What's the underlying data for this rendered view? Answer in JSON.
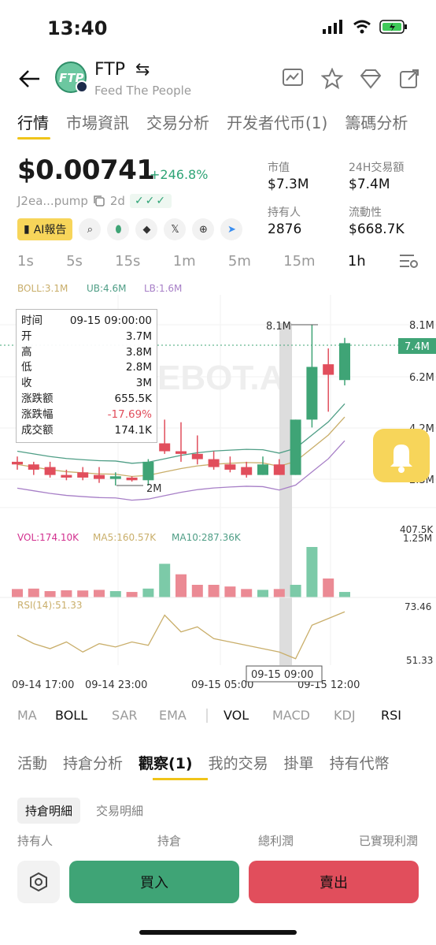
{
  "status": {
    "time": "13:40"
  },
  "header": {
    "symbol": "FTP",
    "logo_text": "FTP",
    "full_name": "Feed The People"
  },
  "tabs": [
    "行情",
    "市場資訊",
    "交易分析",
    "开发者代币(1)",
    "籌碼分析"
  ],
  "price": {
    "value": "$0.00741",
    "change": "+246.8%"
  },
  "token": {
    "address": "J2ea...pump",
    "age": "2d",
    "checks": "✓✓✓"
  },
  "stats": {
    "market_cap_label": "市值",
    "market_cap": "$7.3M",
    "volume_label": "24H交易額",
    "volume": "$7.4M",
    "holders_label": "持有人",
    "holders": "2876",
    "liquidity_label": "流動性",
    "liquidity": "$668.7K"
  },
  "ai_button": "AI報告",
  "intervals": [
    "1s",
    "5s",
    "15s",
    "1m",
    "5m",
    "15m",
    "1h"
  ],
  "chart": {
    "boll": "BOLL:3.1M",
    "ub": "UB:4.6M",
    "lb": "LB:1.6M",
    "y_labels": [
      "8.1M",
      "6.2M",
      "4.2M",
      "2.3M"
    ],
    "current_price_label": "7.4M",
    "high_marker": "8.1M",
    "low_marker": "2M",
    "watermark": "EBOT.A",
    "vol": "VOL:174.10K",
    "ma5": "MA5:160.57K",
    "ma10": "MA10:287.36K",
    "vol_top": "407.5K",
    "vol_mid": "1.25M",
    "rsi": "RSI(14):51.33",
    "rsi_top": "73.46",
    "rsi_bottom": "51.33",
    "x_labels": [
      "09-14 17:00",
      "09-14 23:00",
      "09-15 05:00",
      "09-15 12:00"
    ],
    "crosshair_time": "09-15 09:00"
  },
  "tooltip": {
    "rows": [
      {
        "k": "时间",
        "v": "09-15 09:00:00"
      },
      {
        "k": "开",
        "v": "3.7M"
      },
      {
        "k": "高",
        "v": "3.8M"
      },
      {
        "k": "低",
        "v": "2.8M"
      },
      {
        "k": "收",
        "v": "3M"
      },
      {
        "k": "涨跌额",
        "v": "655.5K"
      },
      {
        "k": "涨跌幅",
        "v": "-17.69%"
      },
      {
        "k": "成交额",
        "v": "174.1K"
      }
    ]
  },
  "chart_data": {
    "type": "candlestick",
    "candles": [
      {
        "o": 2.9,
        "h": 3.1,
        "l": 2.6,
        "c": 2.8
      },
      {
        "o": 2.8,
        "h": 2.9,
        "l": 2.4,
        "c": 2.6
      },
      {
        "o": 2.7,
        "h": 2.9,
        "l": 2.3,
        "c": 2.4
      },
      {
        "o": 2.4,
        "h": 2.6,
        "l": 2.2,
        "c": 2.3
      },
      {
        "o": 2.5,
        "h": 2.7,
        "l": 2.2,
        "c": 2.3
      },
      {
        "o": 2.4,
        "h": 2.7,
        "l": 2.1,
        "c": 2.25
      },
      {
        "o": 2.25,
        "h": 2.5,
        "l": 2.0,
        "c": 2.35
      },
      {
        "o": 2.3,
        "h": 2.35,
        "l": 2.15,
        "c": 2.2
      },
      {
        "o": 2.2,
        "h": 3.0,
        "l": 2.0,
        "c": 2.9
      },
      {
        "o": 3.6,
        "h": 4.5,
        "l": 3.2,
        "c": 3.3
      },
      {
        "o": 3.3,
        "h": 4.4,
        "l": 2.9,
        "c": 3.2
      },
      {
        "o": 3.2,
        "h": 3.9,
        "l": 2.8,
        "c": 3.0
      },
      {
        "o": 3.0,
        "h": 3.3,
        "l": 2.6,
        "c": 2.7
      },
      {
        "o": 2.8,
        "h": 3.1,
        "l": 2.5,
        "c": 2.6
      },
      {
        "o": 2.7,
        "h": 2.9,
        "l": 2.3,
        "c": 2.4
      },
      {
        "o": 2.4,
        "h": 3.1,
        "l": 2.4,
        "c": 2.8
      },
      {
        "o": 2.8,
        "h": 3.0,
        "l": 2.4,
        "c": 2.4
      },
      {
        "o": 2.4,
        "h": 4.5,
        "l": 2.4,
        "c": 4.5
      },
      {
        "o": 4.5,
        "h": 8.1,
        "l": 4.2,
        "c": 6.5
      },
      {
        "o": 6.6,
        "h": 7.2,
        "l": 4.8,
        "c": 6.2
      },
      {
        "o": 6.0,
        "h": 7.6,
        "l": 5.8,
        "c": 7.4
      }
    ],
    "volumes": [
      40,
      42,
      30,
      34,
      33,
      36,
      30,
      26,
      42,
      160,
      110,
      60,
      60,
      52,
      40,
      36,
      40,
      60,
      240,
      90,
      26
    ],
    "vol_colors": [
      "red",
      "red",
      "red",
      "red",
      "red",
      "red",
      "green",
      "red",
      "green",
      "green",
      "red",
      "red",
      "red",
      "red",
      "red",
      "green",
      "red",
      "green",
      "green",
      "red",
      "green"
    ],
    "ylim": [
      2.0,
      8.1
    ]
  },
  "indicators": {
    "main": [
      "MA",
      "BOLL",
      "SAR",
      "EMA"
    ],
    "sub": [
      "VOL",
      "MACD",
      "KDJ",
      "RSI"
    ]
  },
  "sub_tabs": [
    "活動",
    "持倉分析",
    "觀察(1)",
    "我的交易",
    "掛單",
    "持有代幣"
  ],
  "detail_tabs": [
    "持倉明細",
    "交易明細"
  ],
  "columns": [
    "持有人",
    "持倉",
    "總利潤",
    "已實現利潤"
  ],
  "actions": {
    "buy": "買入",
    "sell": "賣出"
  },
  "colors": {
    "up": "#3fa476",
    "down": "#e14e5c",
    "accent": "#f7d55a"
  }
}
